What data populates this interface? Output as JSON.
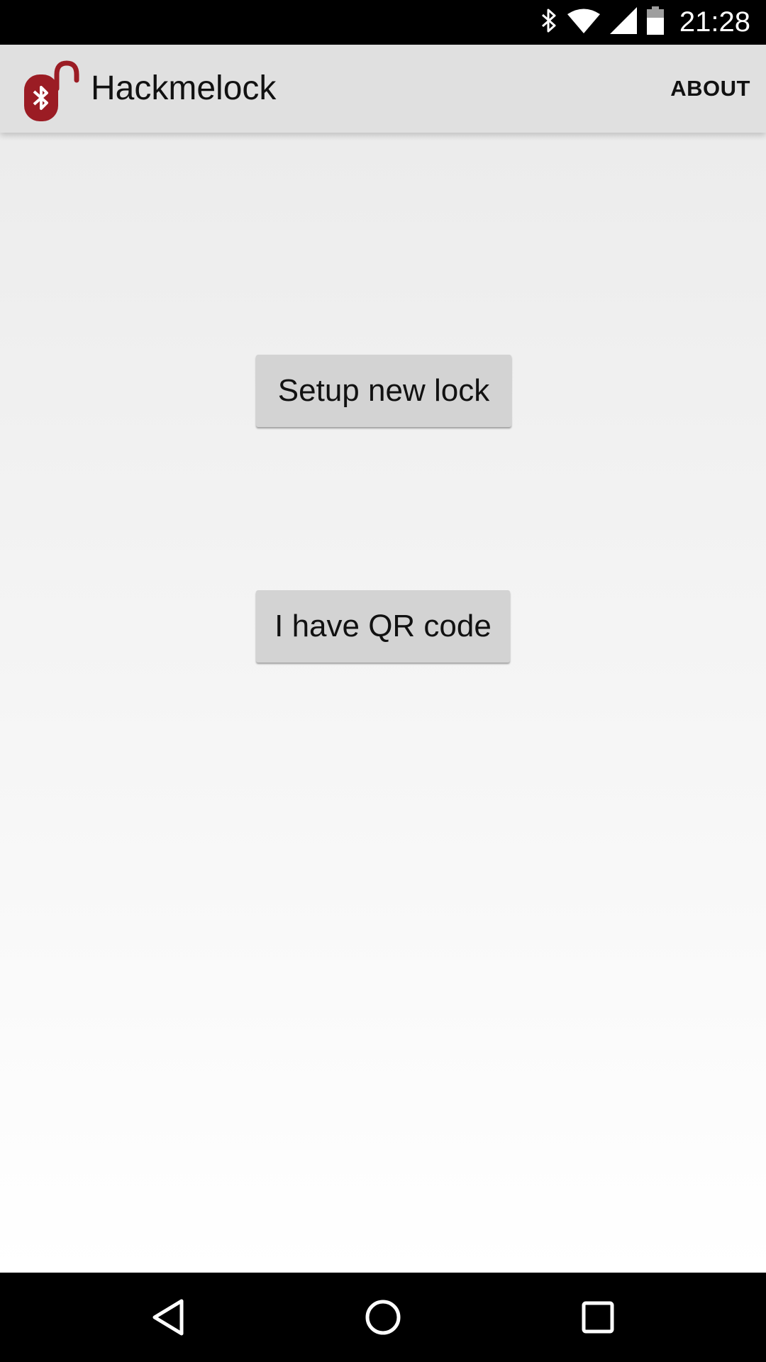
{
  "status_bar": {
    "time": "21:28",
    "icons": [
      "bluetooth-icon",
      "wifi-icon",
      "signal-icon",
      "battery-icon"
    ]
  },
  "app_bar": {
    "title": "Hackmelock",
    "logo": "lock-logo",
    "about_label": "ABOUT"
  },
  "main": {
    "setup_button_label": "Setup new lock",
    "qr_button_label": "I have QR code"
  },
  "nav_bar": {
    "icons": [
      "back-icon",
      "home-icon",
      "recents-icon"
    ]
  },
  "colors": {
    "logo": "#9b1c24",
    "app_bar": "#e0e0e0",
    "button": "#d3d3d3"
  }
}
